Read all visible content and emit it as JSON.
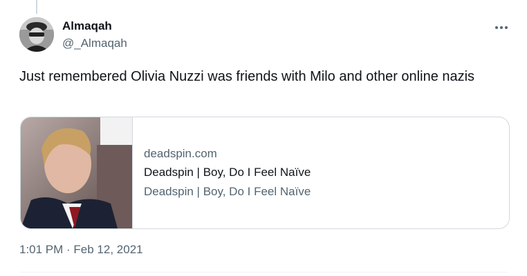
{
  "tweet": {
    "author": {
      "display_name": "Almaqah",
      "handle": "@_Almaqah"
    },
    "text": "Just remembered Olivia Nuzzi was friends with Milo and other online nazis",
    "card": {
      "domain": "deadspin.com",
      "title": "Deadspin | Boy, Do I Feel Naïve",
      "description": "Deadspin | Boy, Do I Feel Naïve"
    },
    "timestamp": "1:01 PM · Feb 12, 2021",
    "more_icon": "more-horizontal-icon"
  },
  "colors": {
    "text_primary": "#0f1419",
    "text_secondary": "#536471",
    "border": "#cfd9de"
  }
}
